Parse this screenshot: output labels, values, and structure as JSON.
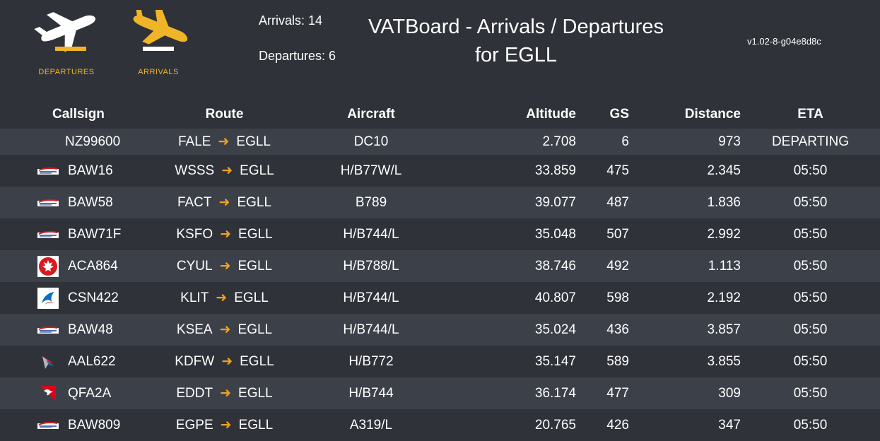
{
  "header": {
    "departures_label": "DEPARTURES",
    "arrivals_label": "ARRIVALS",
    "arrivals_count": "Arrivals: 14",
    "departures_count": "Departures: 6",
    "title_line1": "VATBoard - Arrivals / Departures",
    "title_line2": "for EGLL",
    "version": "v1.02-8-g04e8d8c"
  },
  "columns": {
    "callsign": "Callsign",
    "route": "Route",
    "aircraft": "Aircraft",
    "altitude": "Altitude",
    "gs": "GS",
    "distance": "Distance",
    "eta": "ETA"
  },
  "flights": [
    {
      "callsign": "NZ99600",
      "airline_logo": "none",
      "origin": "FALE",
      "destination": "EGLL",
      "aircraft": "DC10",
      "altitude": "2.708",
      "gs": "6",
      "distance": "973",
      "eta": "DEPARTING"
    },
    {
      "callsign": "BAW16",
      "airline_logo": "british-airways-logo",
      "origin": "WSSS",
      "destination": "EGLL",
      "aircraft": "H/B77W/L",
      "altitude": "33.859",
      "gs": "475",
      "distance": "2.345",
      "eta": "05:50"
    },
    {
      "callsign": "BAW58",
      "airline_logo": "british-airways-logo",
      "origin": "FACT",
      "destination": "EGLL",
      "aircraft": "B789",
      "altitude": "39.077",
      "gs": "487",
      "distance": "1.836",
      "eta": "05:50"
    },
    {
      "callsign": "BAW71F",
      "airline_logo": "british-airways-logo",
      "origin": "KSFO",
      "destination": "EGLL",
      "aircraft": "H/B744/L",
      "altitude": "35.048",
      "gs": "507",
      "distance": "2.992",
      "eta": "05:50"
    },
    {
      "callsign": "ACA864",
      "airline_logo": "air-canada-logo",
      "origin": "CYUL",
      "destination": "EGLL",
      "aircraft": "H/B788/L",
      "altitude": "38.746",
      "gs": "492",
      "distance": "1.113",
      "eta": "05:50"
    },
    {
      "callsign": "CSN422",
      "airline_logo": "china-southern-logo",
      "origin": "KLIT",
      "destination": "EGLL",
      "aircraft": "H/B744/L",
      "altitude": "40.807",
      "gs": "598",
      "distance": "2.192",
      "eta": "05:50"
    },
    {
      "callsign": "BAW48",
      "airline_logo": "british-airways-logo",
      "origin": "KSEA",
      "destination": "EGLL",
      "aircraft": "H/B744/L",
      "altitude": "35.024",
      "gs": "436",
      "distance": "3.857",
      "eta": "05:50"
    },
    {
      "callsign": "AAL622",
      "airline_logo": "american-airlines-logo",
      "origin": "KDFW",
      "destination": "EGLL",
      "aircraft": "H/B772",
      "altitude": "35.147",
      "gs": "589",
      "distance": "3.855",
      "eta": "05:50"
    },
    {
      "callsign": "QFA2A",
      "airline_logo": "qantas-logo",
      "origin": "EDDT",
      "destination": "EGLL",
      "aircraft": "H/B744",
      "altitude": "36.174",
      "gs": "477",
      "distance": "309",
      "eta": "05:50"
    },
    {
      "callsign": "BAW809",
      "airline_logo": "british-airways-logo",
      "origin": "EGPE",
      "destination": "EGLL",
      "aircraft": "A319/L",
      "altitude": "20.765",
      "gs": "426",
      "distance": "347",
      "eta": "05:50"
    }
  ],
  "colors": {
    "background": "#2f3238",
    "row_alt": "#3c4048",
    "accent": "#f0b429",
    "arrow": "#f0a020"
  }
}
